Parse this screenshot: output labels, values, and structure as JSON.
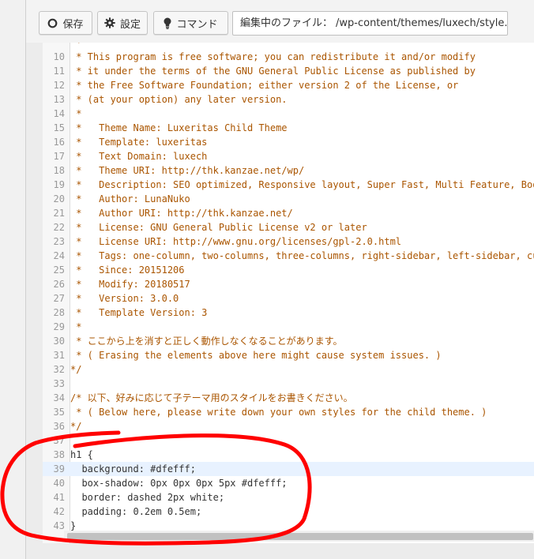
{
  "toolbar": {
    "save_label": "保存",
    "settings_label": "設定",
    "command_label": "コマンド"
  },
  "file_info": {
    "label": "編集中のファイル：",
    "path": "/wp-content/themes/luxech/style.css"
  },
  "editor": {
    "lines": [
      {
        "n": "",
        "t": " *"
      },
      {
        "n": "10",
        "t": " * This program is free software; you can redistribute it and/or modify"
      },
      {
        "n": "11",
        "t": " * it under the terms of the GNU General Public License as published by"
      },
      {
        "n": "12",
        "t": " * the Free Software Foundation; either version 2 of the License, or"
      },
      {
        "n": "13",
        "t": " * (at your option) any later version."
      },
      {
        "n": "14",
        "t": " *"
      },
      {
        "n": "15",
        "t": " *   Theme Name: Luxeritas Child Theme"
      },
      {
        "n": "16",
        "t": " *   Template: luxeritas"
      },
      {
        "n": "17",
        "t": " *   Text Domain: luxech"
      },
      {
        "n": "18",
        "t": " *   Theme URI: http://thk.kanzae.net/wp/"
      },
      {
        "n": "19",
        "t": " *   Description: SEO optimized, Responsive layout, Super Fast, Multi Feature, Bootstrap"
      },
      {
        "n": "20",
        "t": " *   Author: LunaNuko"
      },
      {
        "n": "21",
        "t": " *   Author URI: http://thk.kanzae.net/"
      },
      {
        "n": "22",
        "t": " *   License: GNU General Public License v2 or later"
      },
      {
        "n": "23",
        "t": " *   License URI: http://www.gnu.org/licenses/gpl-2.0.html"
      },
      {
        "n": "24",
        "t": " *   Tags: one-column, two-columns, three-columns, right-sidebar, left-sidebar, custom-head"
      },
      {
        "n": "25",
        "t": " *   Since: 20151206"
      },
      {
        "n": "26",
        "t": " *   Modify: 20180517"
      },
      {
        "n": "27",
        "t": " *   Version: 3.0.0"
      },
      {
        "n": "28",
        "t": " *   Template Version: 3"
      },
      {
        "n": "29",
        "t": " *"
      },
      {
        "n": "30",
        "t": " * ここから上を消すと正しく動作しなくなることがあります。"
      },
      {
        "n": "31",
        "t": " * ( Erasing the elements above here might cause system issues. )"
      },
      {
        "n": "32",
        "t": "*/"
      },
      {
        "n": "33",
        "t": ""
      },
      {
        "n": "34",
        "t": "/* 以下、好みに応じて子テーマ用のスタイルをお書きください。"
      },
      {
        "n": "35",
        "t": " * ( Below here, please write down your own styles for the child theme. )"
      },
      {
        "n": "36",
        "t": "*/"
      },
      {
        "n": "37",
        "t": ""
      },
      {
        "n": "38",
        "t": "h1 {"
      },
      {
        "n": "39",
        "t": "  background: #dfefff;"
      },
      {
        "n": "40",
        "t": "  box-shadow: 0px 0px 0px 5px #dfefff;"
      },
      {
        "n": "41",
        "t": "  border: dashed 2px white;"
      },
      {
        "n": "42",
        "t": "  padding: 0.2em 0.5em;"
      },
      {
        "n": "43",
        "t": "}"
      }
    ],
    "active_line": "39"
  },
  "colors": {
    "comment": "#aa5500",
    "active_line_bg": "#e8f2ff",
    "highlight_circle": "#ff0000"
  }
}
